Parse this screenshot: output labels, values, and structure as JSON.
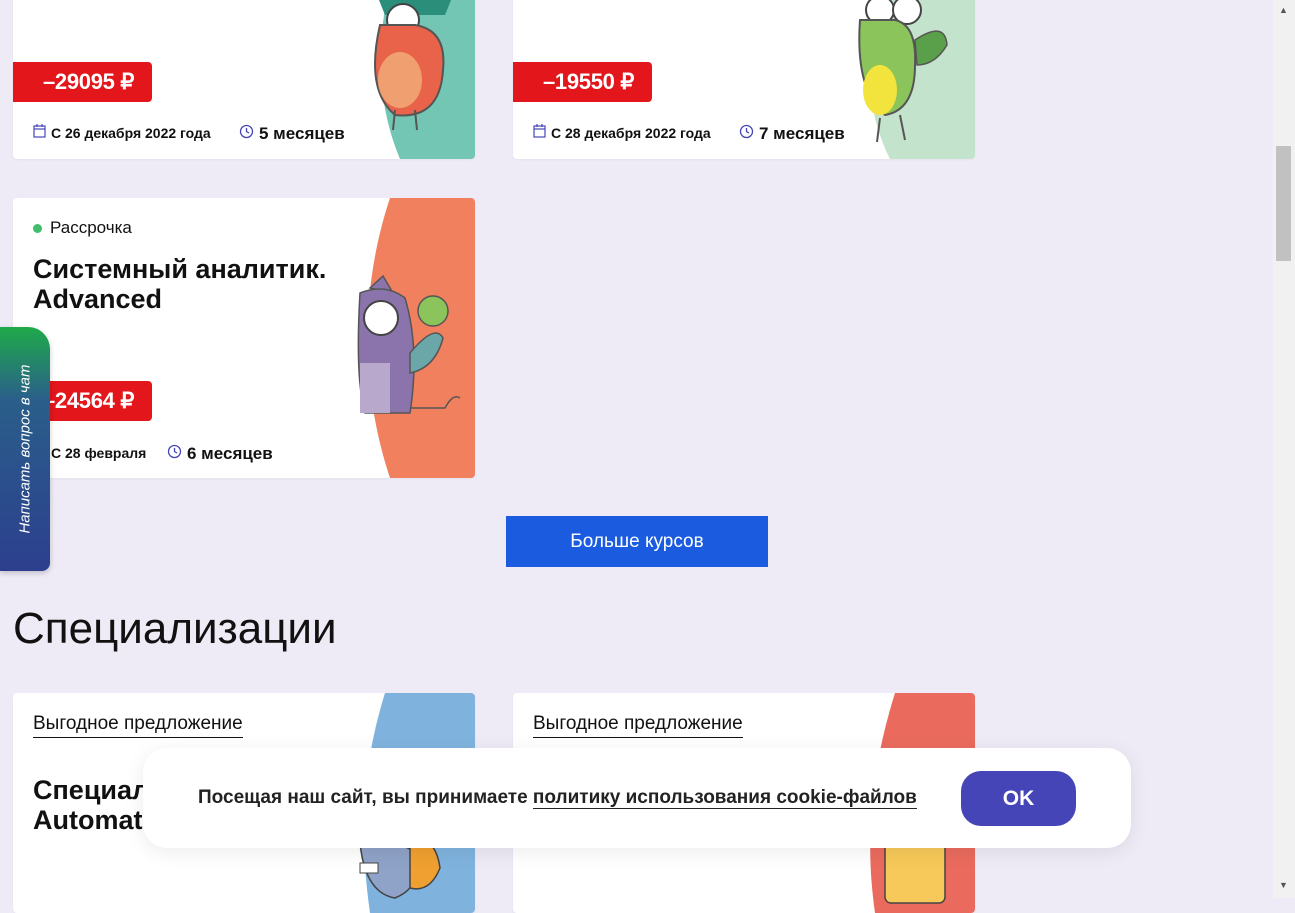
{
  "cards": [
    {
      "badge": "–29095 ₽",
      "date": "С 26 декабря 2022 года",
      "duration": "5 месяцев"
    },
    {
      "badge": "–19550 ₽",
      "date": "С 28 декабря 2022 года",
      "duration": "7 месяцев"
    },
    {
      "tag": "Рассрочка",
      "title": "Системный аналитик. Advanced",
      "badge": "–24564 ₽",
      "date": "С 28 февраля",
      "duration": "6 месяцев"
    }
  ],
  "more_button": "Больше курсов",
  "section_title": "Специализации",
  "spec_cards": [
    {
      "offer": "Выгодное предложение",
      "title": "Специализация QA Automation"
    },
    {
      "offer": "Выгодное предложение"
    }
  ],
  "chat_tab": "Написать вопрос в чат",
  "cookie": {
    "text": "Посещая наш сайт, вы принимаете ",
    "link": "политику использования cookie-файлов",
    "ok": "OK"
  },
  "colors": {
    "badge": "#e3161c",
    "button": "#1a5be0",
    "ok": "#4645b8",
    "background": "#eeeaf6"
  },
  "icons": [
    "calendar-icon",
    "clock-icon",
    "chevron-up-icon",
    "chevron-down-icon"
  ]
}
